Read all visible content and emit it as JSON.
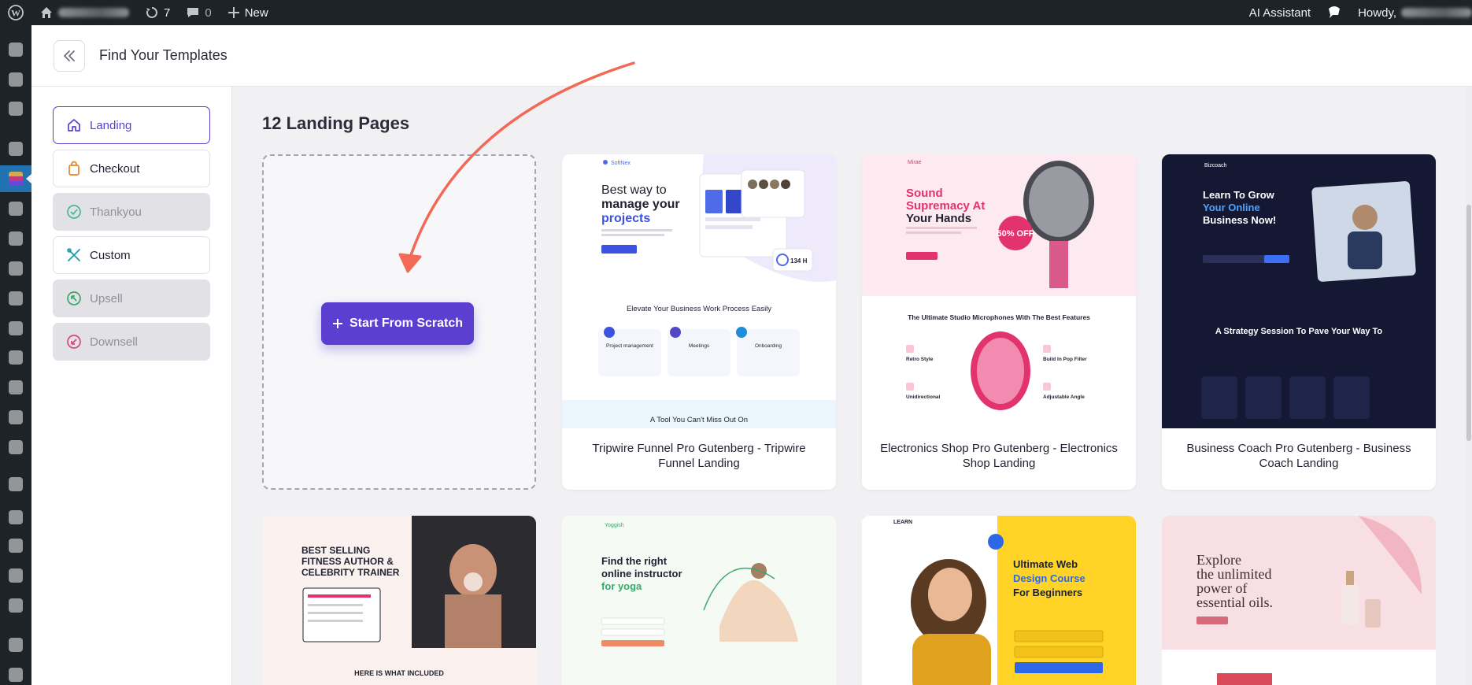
{
  "admin_bar": {
    "updates_count": "7",
    "comments_count": "0",
    "new_label": "New",
    "ai_assistant_label": "AI Assistant",
    "howdy_label": "Howdy,"
  },
  "header": {
    "title": "Find Your Templates"
  },
  "categories": [
    {
      "label": "Landing",
      "state": "active",
      "icon": "home-icon"
    },
    {
      "label": "Checkout",
      "state": "normal",
      "icon": "bag-icon"
    },
    {
      "label": "Thankyou",
      "state": "disabled",
      "icon": "check-circle-icon"
    },
    {
      "label": "Custom",
      "state": "normal",
      "icon": "tools-icon"
    },
    {
      "label": "Upsell",
      "state": "disabled",
      "icon": "arrow-up-left-circle-icon"
    },
    {
      "label": "Downsell",
      "state": "disabled",
      "icon": "arrow-down-left-circle-icon"
    }
  ],
  "main": {
    "title": "12 Landing Pages",
    "scratch_label": "Start From Scratch"
  },
  "templates": [
    {
      "name": "Tripwire Funnel Pro Gutenberg - Tripwire Funnel Landing",
      "preview": {
        "brand": "SoftNex",
        "headline": [
          "Best way to",
          "manage your",
          "projects"
        ],
        "section_title": "Elevate Your Business Work Process Easily",
        "features": [
          "Project management",
          "Meetings",
          "Onboarding"
        ],
        "bottom_title": "A Tool You Can't Miss Out On",
        "stat": "134 H"
      }
    },
    {
      "name": "Electronics Shop Pro Gutenberg - Electronics Shop Landing",
      "preview": {
        "brand": "Mirae",
        "headline": [
          "Sound",
          "Supremacy At",
          "Your Hands"
        ],
        "badge": "50% OFF",
        "section_title": "The Ultimate Studio Microphones With The Best Features",
        "features": [
          "Retro Style",
          "Build In Pop Filter",
          "Unidirectional",
          "Adjustable Angle"
        ]
      }
    },
    {
      "name": "Business Coach Pro Gutenberg - Business Coach Landing",
      "preview": {
        "brand": "Bizcoach",
        "headline": [
          "Learn To Grow",
          "Your Online",
          "Business Now!"
        ],
        "section_title": "A Strategy Session To Pave Your Way To"
      }
    }
  ],
  "row2_previews": [
    {
      "headline": [
        "BEST SELLING",
        "FITNESS AUTHOR &",
        "CELEBRITY TRAINER"
      ],
      "sub": "HERE IS WHAT INCLUDED"
    },
    {
      "brand": "Yoggish",
      "headline": [
        "Find the right",
        "online instructor",
        "for yoga"
      ]
    },
    {
      "brand": "LEARN",
      "headline": [
        "Ultimate Web",
        "Design Course",
        "For Beginners"
      ]
    },
    {
      "headline": [
        "Explore",
        "the unlimited",
        "power of",
        "essential oils."
      ]
    }
  ],
  "colors": {
    "accent": "#5b3fd0",
    "arrow": "#f26a57",
    "admin_bar": "#1d2327"
  }
}
